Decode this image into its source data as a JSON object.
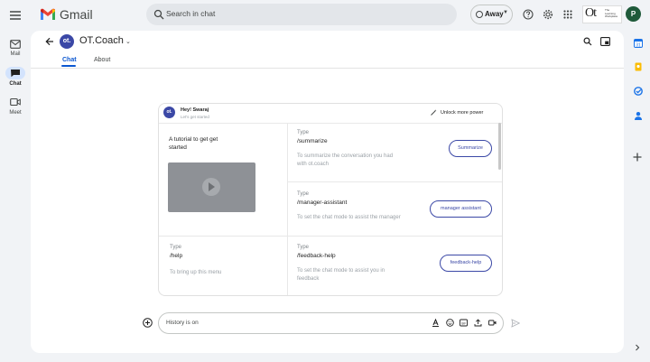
{
  "topbar": {
    "app_name": "Gmail",
    "search_placeholder": "Search in chat",
    "status": "Away",
    "org_logo_text": "Ot",
    "org_tagline": "The Learning Workplace",
    "avatar_letter": "P"
  },
  "left_rail": {
    "items": [
      {
        "label": "Mail",
        "icon": "mail-icon"
      },
      {
        "label": "Chat",
        "icon": "chat-icon",
        "selected": true
      },
      {
        "label": "Meet",
        "icon": "video-icon"
      }
    ]
  },
  "chat_header": {
    "avatar_text": "ot.",
    "name": "OT.Coach",
    "tabs": [
      {
        "label": "Chat",
        "selected": true
      },
      {
        "label": "About",
        "selected": false
      }
    ]
  },
  "card": {
    "avatar_text": "ot.",
    "greeting": "Hey! Swaraj",
    "subtitle": "Let's get started",
    "unlock_label": "Unlock more power",
    "tutorial_title": "A tutorial to get get started",
    "commands": [
      {
        "type_label": "Type",
        "command": "/summarize",
        "description": "To summarize the conversation you had with ot.coach",
        "button": "Summarize"
      },
      {
        "type_label": "Type",
        "command": "/manager-assistant",
        "description": "To set the chat mode to assist the manager",
        "button": "manager assistant"
      },
      {
        "type_label": "Type",
        "command": "/help",
        "description": "To bring up this menu",
        "button": ""
      },
      {
        "type_label": "Type",
        "command": "/feedback-help",
        "description": "To set the chat mode to assist you in feedback",
        "button": "feedback-help"
      }
    ]
  },
  "compose": {
    "placeholder": "History is on"
  },
  "colors": {
    "accent": "#0b57d0",
    "brand": "#3b48a6",
    "background": "#f1f3f6"
  }
}
